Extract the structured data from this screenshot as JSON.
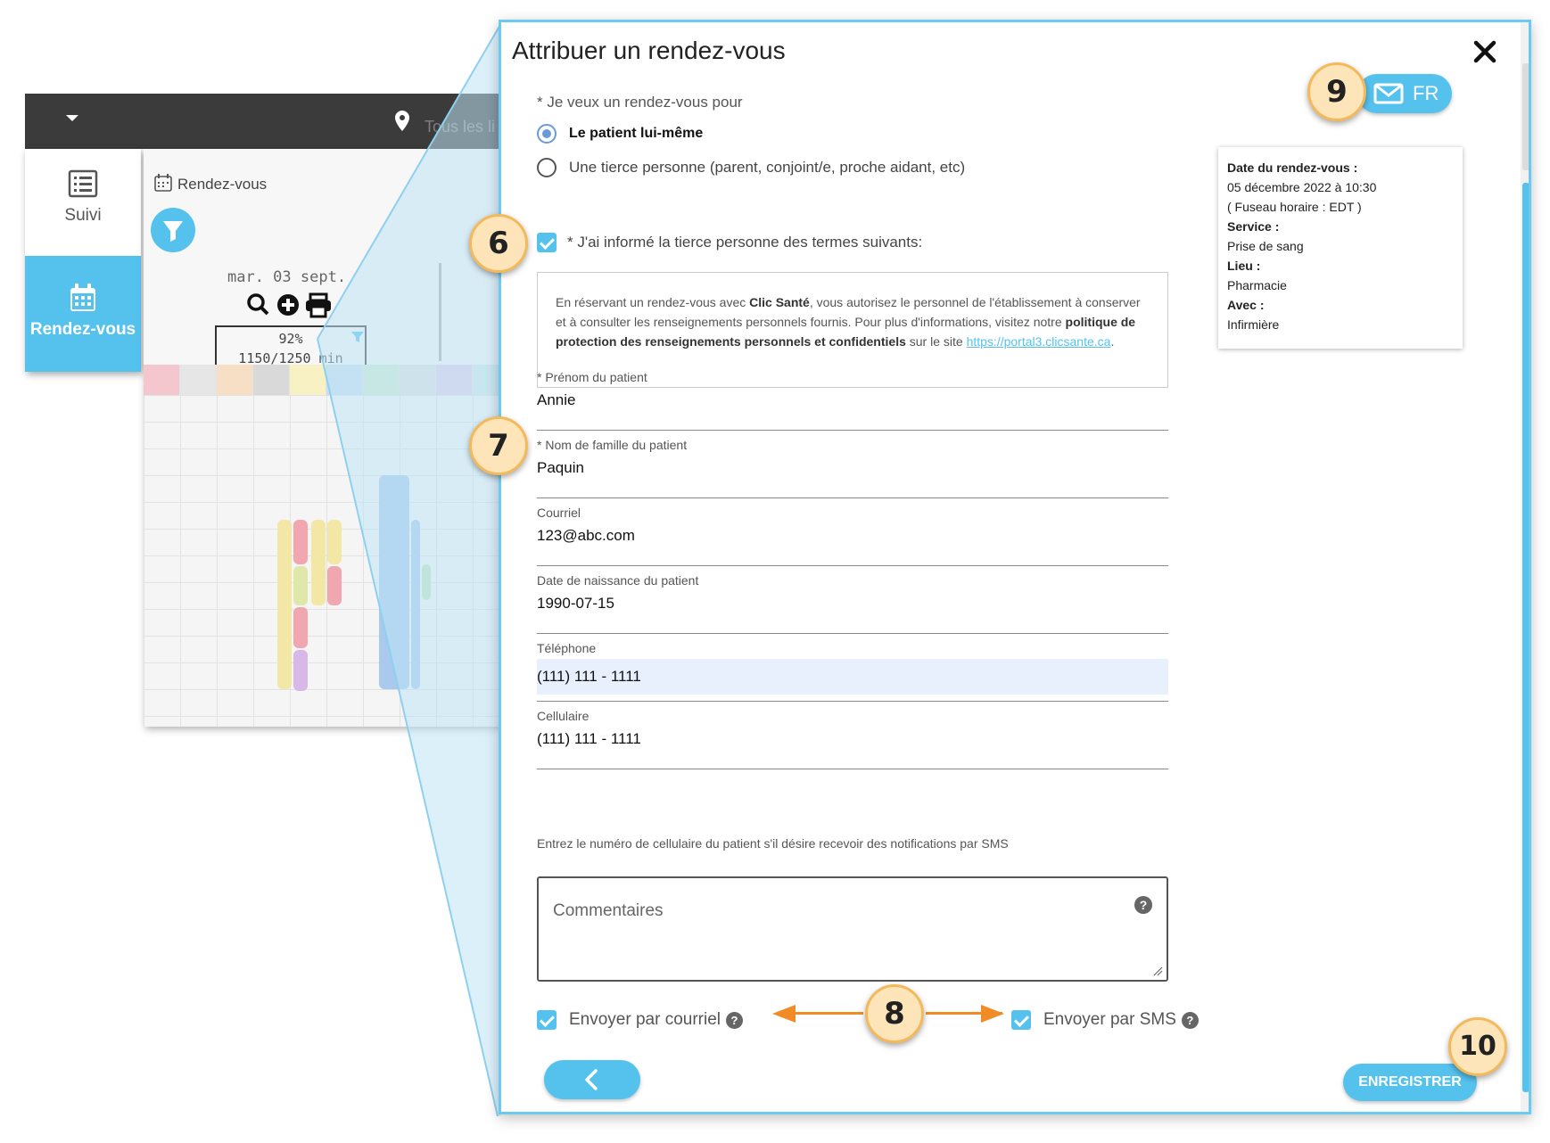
{
  "background_app": {
    "location_text": "Tous les li",
    "nav": [
      {
        "label": "Suivi"
      },
      {
        "label": "Rendez-vous"
      }
    ],
    "calendar": {
      "title": "Rendez-vous",
      "date": "mar. 03 sept.",
      "stat_percent": "92%",
      "stat_minutes": "1150/1250 min"
    }
  },
  "modal": {
    "title": "Attribuer un rendez-vous",
    "question": "* Je veux un rendez-vous pour",
    "options": [
      {
        "label": "Le patient lui-même",
        "selected": true
      },
      {
        "label": "Une tierce personne (parent, conjoint/e, proche aidant, etc)",
        "selected": false
      }
    ],
    "informed_label": "* J'ai informé la tierce personne des termes suivants:",
    "terms": {
      "part1": "En réservant un rendez-vous avec ",
      "brand": "Clic Santé",
      "part2": ", vous autorisez le personnel de l'établissement à conserver et à consulter les renseignements personnels fournis. Pour plus d'informations, visitez notre ",
      "policy": "politique de protection des renseignements personnels et confidentiels",
      "part3": " sur le site ",
      "link": "https://portal3.clicsante.ca",
      "end": "."
    },
    "fields": {
      "first_name": {
        "label": "* Prénom du patient",
        "value": "Annie"
      },
      "last_name": {
        "label": "* Nom de famille du patient",
        "value": "Paquin"
      },
      "email": {
        "label": "Courriel",
        "value": "123@abc.com"
      },
      "birthdate": {
        "label": "Date de naissance du patient",
        "value": "1990-07-15"
      },
      "phone": {
        "label": "Téléphone",
        "value": "(111) 111 - 1111"
      },
      "cell": {
        "label": "Cellulaire",
        "value": "(111) 111 - 1111"
      }
    },
    "cell_hint": "Entrez le numéro de cellulaire du patient s'il désire recevoir des notifications par SMS",
    "comments_placeholder": "Commentaires",
    "help_glyph": "?",
    "send_email_label": "Envoyer par courriel",
    "send_sms_label": "Envoyer par SMS",
    "save_label": "ENREGISTRER",
    "lang_label": "FR",
    "summary": {
      "date_key": "Date du rendez-vous :",
      "date_val": "05 décembre 2022 à 10:30",
      "tz": "( Fuseau horaire : EDT )",
      "service_key": "Service :",
      "service_val": "Prise de sang",
      "place_key": "Lieu :",
      "place_val": "Pharmacie",
      "with_key": "Avec :",
      "with_val": "Infirmière"
    }
  },
  "callouts": [
    "6",
    "7",
    "8",
    "9",
    "10"
  ],
  "colors": {
    "accent": "#55c2ee",
    "callout_fill": "#fde5b9",
    "callout_border": "#f4b95a",
    "arrow": "#f08b25"
  }
}
